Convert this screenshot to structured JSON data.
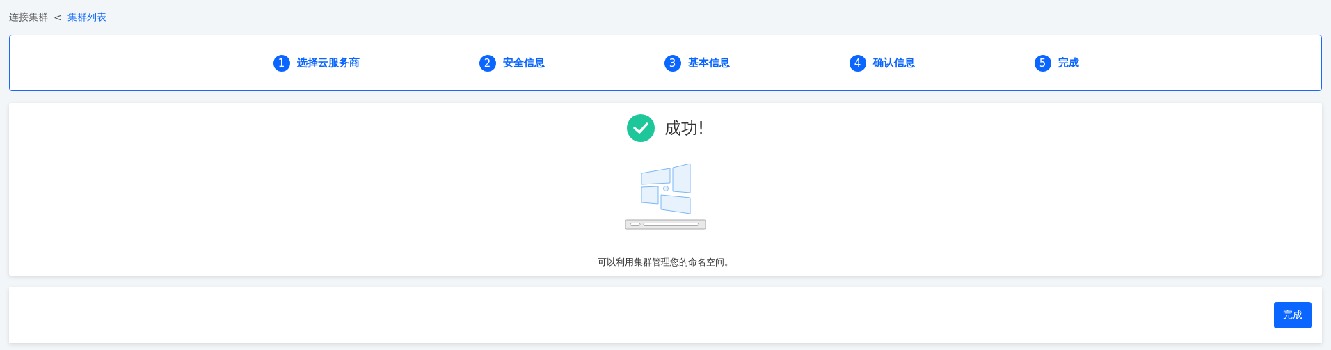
{
  "breadcrumb": [
    {
      "label": "连接集群",
      "link": false
    },
    {
      "label": "集群列表",
      "link": true
    }
  ],
  "breadcrumb_separator": "<",
  "steps": [
    {
      "number": "1",
      "label": "选择云服务商",
      "done": true
    },
    {
      "number": "2",
      "label": "安全信息",
      "done": true
    },
    {
      "number": "3",
      "label": "基本信息",
      "done": true
    },
    {
      "number": "4",
      "label": "确认信息",
      "done": true
    },
    {
      "number": "5",
      "label": "完成",
      "done": true
    }
  ],
  "result": {
    "title": "成功!",
    "message": "可以利用集群管理您的命名空间。"
  },
  "footer": {
    "button": "完成"
  }
}
